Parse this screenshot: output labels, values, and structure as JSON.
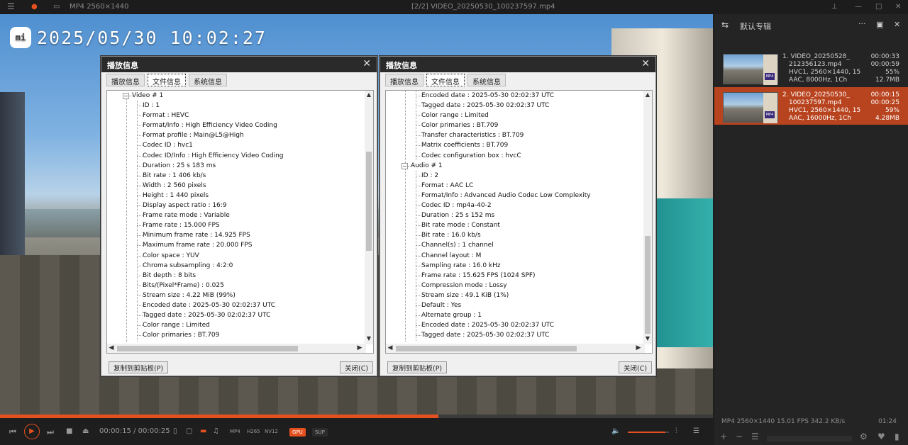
{
  "titlebar": {
    "file_info": "MP4 2560×1440",
    "title": "[2/2] VIDEO_20250530_100237597.mp4"
  },
  "video": {
    "timestamp": "2025/05/30 10:02:27",
    "logo": "mi"
  },
  "dialog_common": {
    "title": "播放信息",
    "tabs": [
      "播放信息",
      "文件信息",
      "系统信息"
    ],
    "active_tab": "文件信息",
    "copy_button": "复制到剪贴板(P)",
    "close_button": "关闭(C)"
  },
  "dialog_left": {
    "section": "Video # 1",
    "lines": [
      "ID : 1",
      "Format : HEVC",
      "Format/Info : High Efficiency Video Coding",
      "Format profile : Main@L5@High",
      "Codec ID : hvc1",
      "Codec ID/Info : High Efficiency Video Coding",
      "Duration : 25 s 183 ms",
      "Bit rate : 1 406 kb/s",
      "Width : 2 560 pixels",
      "Height : 1 440 pixels",
      "Display aspect ratio : 16:9",
      "Frame rate mode : Variable",
      "Frame rate : 15.000 FPS",
      "Minimum frame rate : 14.925 FPS",
      "Maximum frame rate : 20.000 FPS",
      "Color space : YUV",
      "Chroma subsampling : 4:2:0",
      "Bit depth : 8 bits",
      "Bits/(Pixel*Frame) : 0.025",
      "Stream size : 4.22 MiB (99%)",
      "Encoded date : 2025-05-30 02:02:37 UTC",
      "Tagged date : 2025-05-30 02:02:37 UTC",
      "Color range : Limited",
      "Color primaries : BT.709"
    ]
  },
  "dialog_right": {
    "lines_top": [
      "Encoded date : 2025-05-30 02:02:37 UTC",
      "Tagged date : 2025-05-30 02:02:37 UTC",
      "Color range : Limited",
      "Color primaries : BT.709",
      "Transfer characteristics : BT.709",
      "Matrix coefficients : BT.709",
      "Codec configuration box : hvcC"
    ],
    "section": "Audio # 1",
    "lines_audio": [
      "ID : 2",
      "Format : AAC LC",
      "Format/Info : Advanced Audio Codec Low Complexity",
      "Codec ID : mp4a-40-2",
      "Duration : 25 s 152 ms",
      "Bit rate mode : Constant",
      "Bit rate : 16.0 kb/s",
      "Channel(s) : 1 channel",
      "Channel layout : M",
      "Sampling rate : 16.0 kHz",
      "Frame rate : 15.625 FPS (1024 SPF)",
      "Compression mode : Lossy",
      "Stream size : 49.1 KiB (1%)",
      "Default : Yes",
      "Alternate group : 1",
      "Encoded date : 2025-05-30 02:02:37 UTC",
      "Tagged date : 2025-05-30 02:02:37 UTC"
    ]
  },
  "sidebar": {
    "title": "默认专辑",
    "items": [
      {
        "name1": "1. VIDEO_20250528_",
        "name2": "212356123.mp4",
        "name3": "HVC1, 2560×1440, 15",
        "name4": "AAC, 8000Hz, 1Ch",
        "m1": "00:00:33",
        "m2": "00:00:59",
        "m3": "55%",
        "m4": "12.7MB"
      },
      {
        "name1": "2. VIDEO_20250530_",
        "name2": "100237597.mp4",
        "name3": "HVC1, 2560×1440, 15",
        "name4": "AAC, 16000Hz, 1Ch",
        "m1": "00:00:15",
        "m2": "00:00:25",
        "m3": "59%",
        "m4": "4.28MB"
      }
    ],
    "status": "MP4   2560×1440   15.01 FPS   342.2 KB/s",
    "duration": "01:24"
  },
  "controls": {
    "time": "00:00:15 / 00:00:25",
    "progress": 0.615,
    "volume": 0.92,
    "format_tags": [
      "MP4",
      "H265",
      "NV12"
    ],
    "gpu": "GPU",
    "sup": "SUP"
  },
  "colors": {
    "accent": "#e4501f",
    "selected": "#b8441f"
  }
}
